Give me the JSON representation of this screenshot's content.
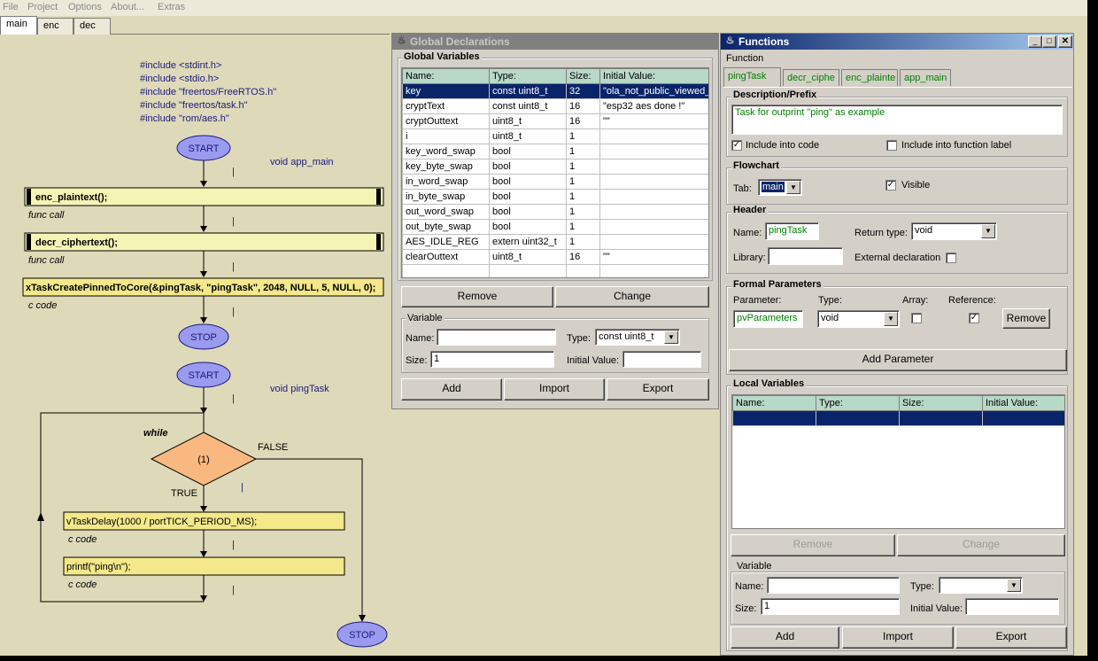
{
  "menu": [
    "File",
    "Project",
    "Options",
    "About...",
    "Extras"
  ],
  "main_tabs": [
    "main",
    "enc",
    "dec"
  ],
  "flowchart": {
    "includes": [
      "#include <stdint.h>",
      "#include <stdio.h>",
      "#include \"freertos/FreeRTOS.h\"",
      "#include \"freertos/task.h\"",
      "#include \"rom/aes.h\""
    ],
    "start_label": "START",
    "stop_label": "STOP",
    "app_main_label": "void app_main",
    "ping_label": "void pingTask",
    "enc_call": "enc_plaintext();",
    "decr_call": "decr_ciphertext();",
    "create_task": "xTaskCreatePinnedToCore(&pingTask, \"pingTask\", 2048, NULL, 5, NULL, 0);",
    "func_call": "func call",
    "c_code": "c code",
    "while_label": "while",
    "cond": "(1)",
    "false_label": "FALSE",
    "true_label": "TRUE",
    "delay": "vTaskDelay(1000 / portTICK_PERIOD_MS);",
    "printf": "printf(\"ping\\n\");"
  },
  "global": {
    "title": "Global Declarations",
    "group": "Global Variables",
    "columns": [
      "Name:",
      "Type:",
      "Size:",
      "Initial Value:"
    ],
    "rows": [
      [
        "key",
        "const uint8_t",
        "32",
        "\"ola_not_public_viewed_"
      ],
      [
        "cryptText",
        "const uint8_t",
        "16",
        "\"esp32 aes done !\""
      ],
      [
        "cryptOuttext",
        "uint8_t",
        "16",
        "\"\""
      ],
      [
        "i",
        "uint8_t",
        "1",
        ""
      ],
      [
        "key_word_swap",
        "bool",
        "1",
        ""
      ],
      [
        "key_byte_swap",
        "bool",
        "1",
        ""
      ],
      [
        "in_word_swap",
        "bool",
        "1",
        ""
      ],
      [
        "in_byte_swap",
        "bool",
        "1",
        ""
      ],
      [
        "out_word_swap",
        "bool",
        "1",
        ""
      ],
      [
        "out_byte_swap",
        "bool",
        "1",
        ""
      ],
      [
        "AES_IDLE_REG",
        "extern uint32_t",
        "1",
        ""
      ],
      [
        "clearOuttext",
        "uint8_t",
        "16",
        "\"\""
      ]
    ],
    "remove": "Remove",
    "change": "Change",
    "var_group": "Variable",
    "name_label": "Name:",
    "type_label": "Type:",
    "type_value": "const uint8_t",
    "size_label": "Size:",
    "size_value": "1",
    "init_label": "Initial Value:",
    "add": "Add",
    "import": "Import",
    "export": "Export"
  },
  "functions": {
    "title": "Functions",
    "menu": "Function",
    "tabs": [
      "pingTask",
      "decr_ciphe",
      "enc_plainte",
      "app_main"
    ],
    "desc_group": "Description/Prefix",
    "desc_text": "Task for outprint \"ping\" as example",
    "include_code": "Include into code",
    "include_label": "Include into function label",
    "flow_group": "Flowchart",
    "tab_label": "Tab:",
    "tab_value": "main",
    "visible": "Visible",
    "header_group": "Header",
    "name_label": "Name:",
    "name_value": "pingTask",
    "return_label": "Return type:",
    "return_value": "void",
    "library_label": "Library:",
    "external": "External declaration",
    "formal_group": "Formal Parameters",
    "param_label": "Parameter:",
    "type_label": "Type:",
    "array_label": "Array:",
    "ref_label": "Reference:",
    "param_value": "pvParameters",
    "param_type": "void",
    "remove": "Remove",
    "add_param": "Add Parameter",
    "local_group": "Local Variables",
    "local_columns": [
      "Name:",
      "Type:",
      "Size:",
      "Initial Value:"
    ],
    "change": "Change",
    "var_group": "Variable",
    "size_label": "Size:",
    "size_value": "1",
    "init_label": "Initial Value:",
    "add": "Add",
    "import": "Import",
    "export": "Export"
  }
}
